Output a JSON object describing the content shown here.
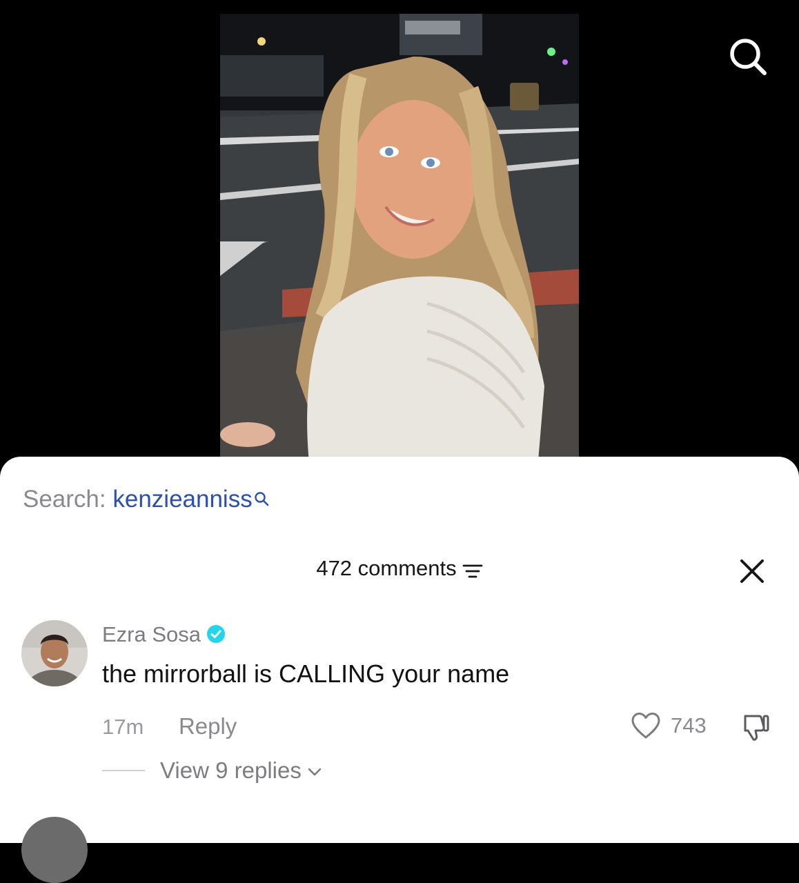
{
  "video": {
    "search_icon": "search-icon"
  },
  "comments_sheet": {
    "search": {
      "prefix": "Search:",
      "term": "kenzieanniss",
      "icon": "search-mini-icon"
    },
    "header": {
      "count_label": "472 comments",
      "sort_icon": "sort-filter-icon",
      "close_icon": "close-icon"
    },
    "comment": {
      "username": "Ezra Sosa",
      "verified_icon": "verified-badge-icon",
      "text": "the mirrorball is CALLING your name",
      "timestamp": "17m",
      "reply_label": "Reply",
      "like_count": "743",
      "like_icon": "heart-icon",
      "dislike_icon": "thumbs-down-icon",
      "view_replies_label": "View 9 replies"
    },
    "colors": {
      "accent_blue": "#2c4fb0",
      "verified_blue": "#20d5ec",
      "muted_text": "#8a8a8e"
    }
  }
}
